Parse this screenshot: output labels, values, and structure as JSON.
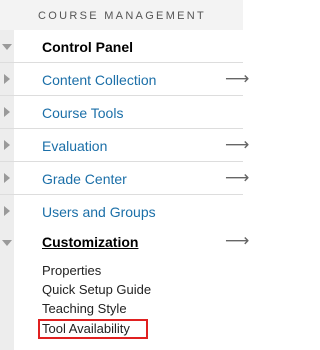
{
  "section": {
    "title": "COURSE MANAGEMENT"
  },
  "control_panel": {
    "label": "Control Panel"
  },
  "items": [
    {
      "label": "Content Collection",
      "has_arrow": true
    },
    {
      "label": "Course Tools",
      "has_arrow": false
    },
    {
      "label": "Evaluation",
      "has_arrow": true
    },
    {
      "label": "Grade Center",
      "has_arrow": true
    },
    {
      "label": "Users and Groups",
      "has_arrow": false
    }
  ],
  "customization": {
    "label": "Customization",
    "children": [
      "Properties",
      "Quick Setup Guide",
      "Teaching Style",
      "Tool Availability"
    ],
    "highlighted": "Tool Availability"
  },
  "glyphs": {
    "arrow": "⟶"
  },
  "colors": {
    "link": "#1b6fa8",
    "highlight": "#e02020"
  }
}
